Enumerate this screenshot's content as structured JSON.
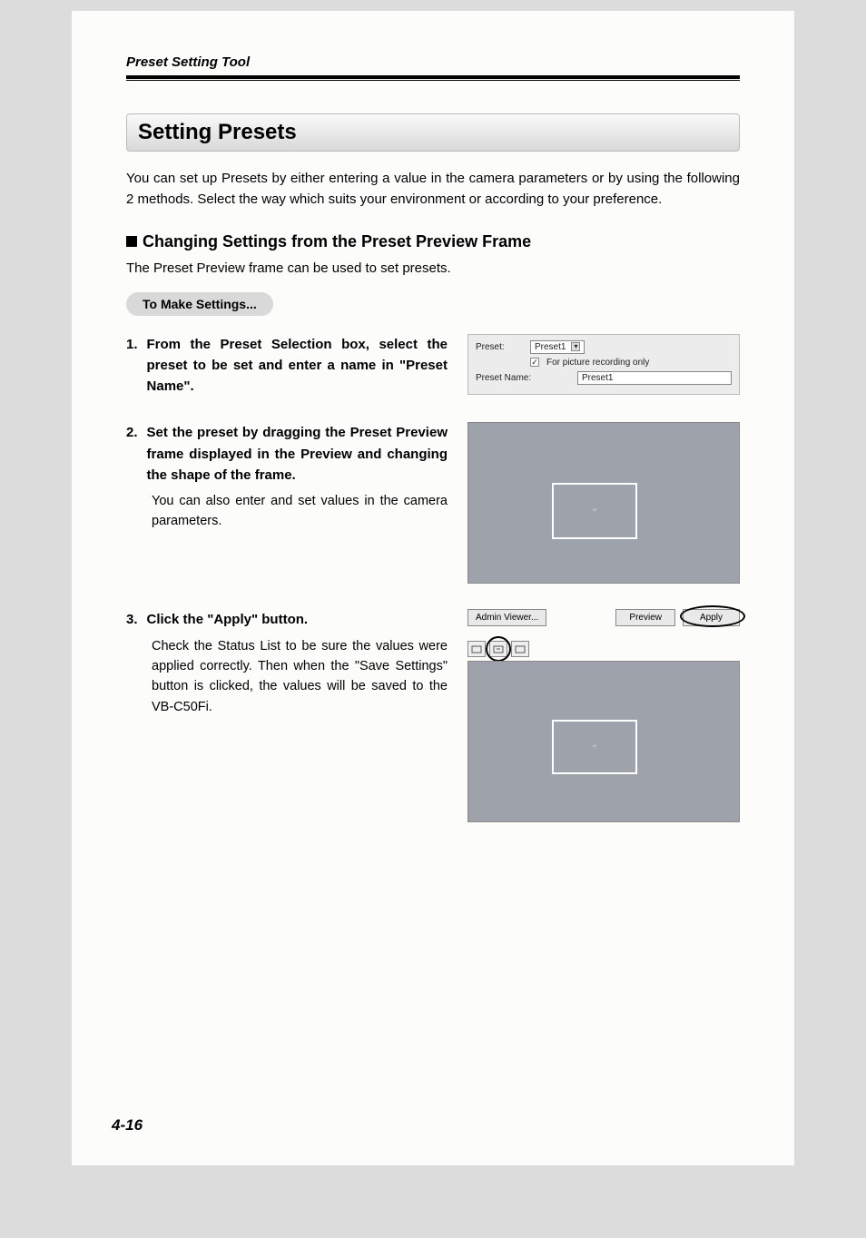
{
  "running_header": "Preset Setting Tool",
  "title": "Setting Presets",
  "intro": "You can set up Presets by either entering a value in the camera parameters or by using the following 2 methods. Select the way which suits your environment or according to your preference.",
  "subheading": "Changing Settings from the Preset Preview Frame",
  "sub_desc": "The Preset Preview frame can be used to set presets.",
  "pill": "To Make Settings...",
  "steps": [
    {
      "num": "1.",
      "title": "From the Preset Selection box, select the preset to be set and enter a name in \"Preset Name\"."
    },
    {
      "num": "2.",
      "title": "Set the preset by dragging the Preset Preview frame displayed in the Preview and changing the shape of the frame.",
      "body": "You can also enter and set values in the camera parameters."
    },
    {
      "num": "3.",
      "title": "Click the \"Apply\" button.",
      "body": "Check the Status List to be sure the values were applied correctly. Then when the \"Save Settings\" button is clicked, the values will be saved to the VB-C50Fi."
    }
  ],
  "fig1": {
    "preset_label": "Preset:",
    "preset_value": "Preset1",
    "checkbox_label": "For picture recording only",
    "preset_name_label": "Preset Name:",
    "preset_name_value": "Preset1"
  },
  "fig3": {
    "btn_admin": "Admin Viewer...",
    "btn_preview": "Preview",
    "btn_apply": "Apply"
  },
  "page_number": "4-16"
}
